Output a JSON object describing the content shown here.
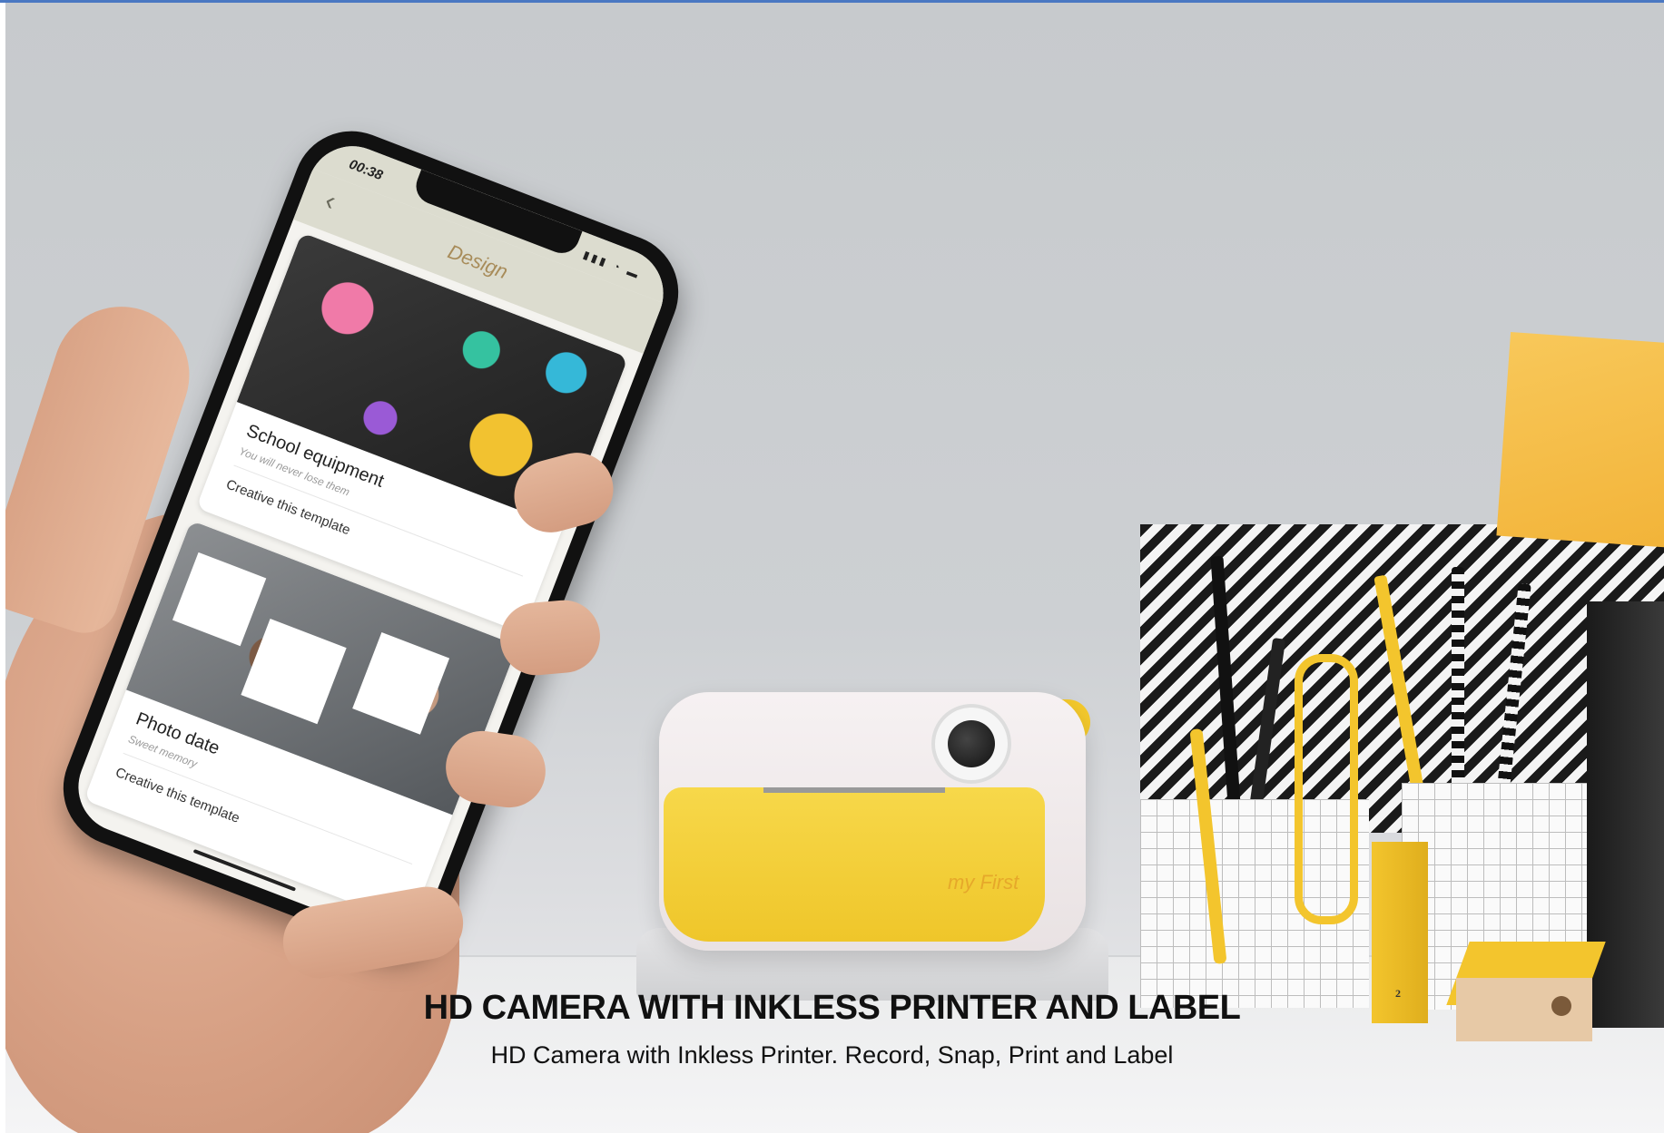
{
  "app": {
    "status_time": "00:38",
    "status_icons": "▮▮▮ ◔ ▬",
    "nav_title": "Design",
    "back_glyph": "‹"
  },
  "templates": [
    {
      "title": "School equipment",
      "subtitle": "You will never lose them",
      "action": "Creative this template"
    },
    {
      "title": "Photo date",
      "subtitle": "Sweet memory",
      "action": "Creative this template"
    }
  ],
  "camera": {
    "brand": "my First"
  },
  "book": {
    "number": "2"
  },
  "caption": {
    "headline": "HD CAMERA WITH INKLESS PRINTER AND LABEL",
    "subline": "HD Camera with Inkless Printer. Record, Snap, Print and Label"
  },
  "colors": {
    "accent_yellow": "#f3c52d",
    "nav_bg": "#dcdccf",
    "nav_title": "#a88c5a"
  }
}
